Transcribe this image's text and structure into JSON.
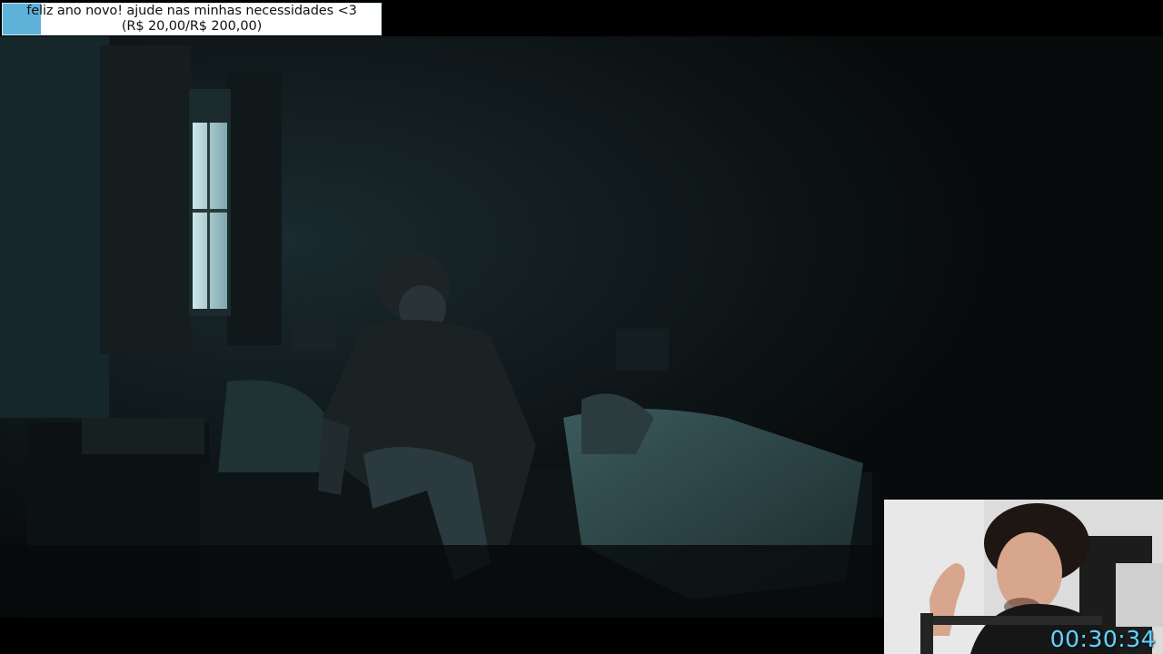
{
  "donation_goal": {
    "message": "feliz ano novo! ajude nas minhas necessidades <3",
    "amounts": "(R$ 20,00/R$ 200,00)",
    "progress_fraction": 0.1,
    "fill_color": "#5fb3da"
  },
  "stream_timer": {
    "value": "00:30:34",
    "color": "#6ad0f2"
  },
  "video": {
    "scene": "dark-bedroom-movie-frame"
  },
  "webcam": {
    "scene": "streamer-webcam"
  }
}
